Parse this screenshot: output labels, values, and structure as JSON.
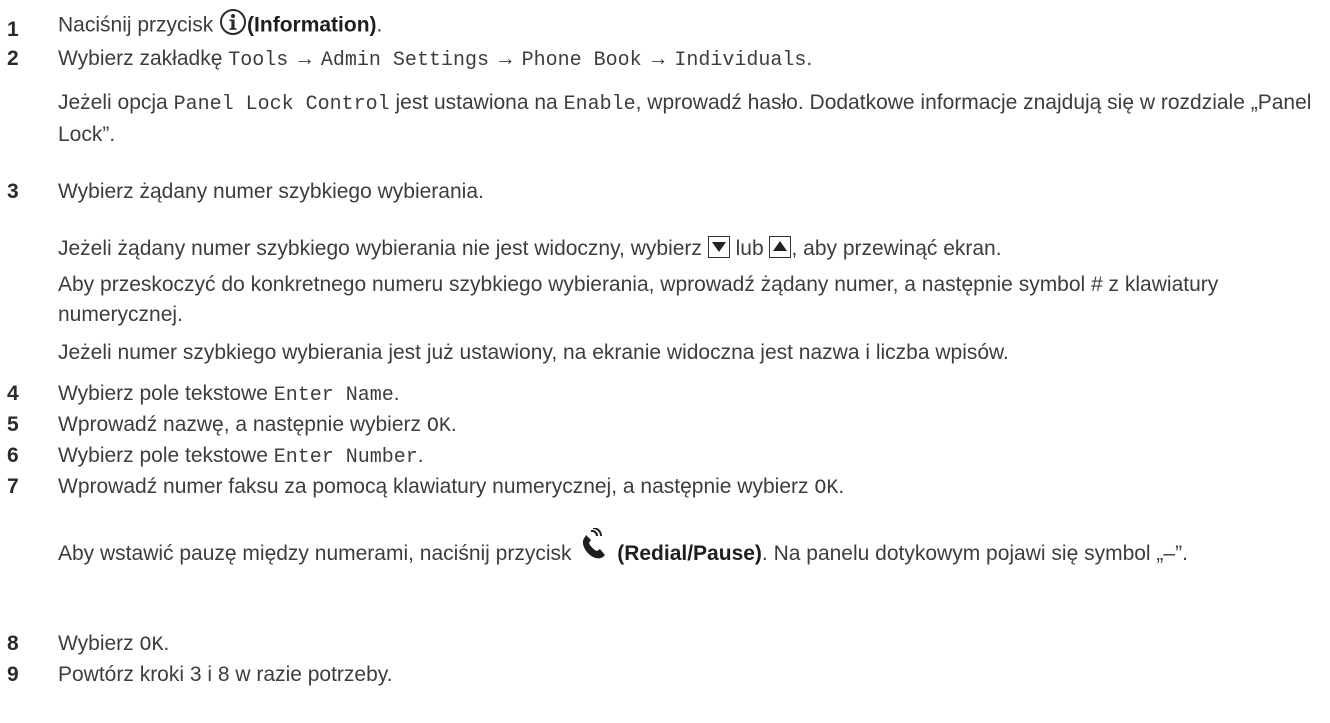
{
  "steps": [
    {
      "num": "1",
      "pre": "Naciśnij przycisk",
      "icon": "info-icon",
      "bold": "(Information)",
      "post": "."
    },
    {
      "num": "2",
      "pre": "Wybierz zakładkę",
      "path": [
        "Tools",
        "Admin Settings",
        "Phone Book",
        "Individuals"
      ],
      "post": "."
    },
    {
      "num": "3",
      "text": "Wybierz żądany numer szybkiego wybierania."
    },
    {
      "num": "4",
      "pre": "Wybierz pole tekstowe",
      "mono": "Enter Name",
      "post": "."
    },
    {
      "num": "5",
      "pre": "Wprowadź nazwę, a następnie wybierz",
      "mono": "OK",
      "post": "."
    },
    {
      "num": "6",
      "pre": "Wybierz pole tekstowe",
      "mono": "Enter Number",
      "post": "."
    },
    {
      "num": "7",
      "pre": "Wprowadź numer faksu za pomocą klawiatury numerycznej, a następnie wybierz",
      "mono": "OK",
      "post": "."
    },
    {
      "num": "8",
      "pre": "Wybierz",
      "mono": "OK",
      "post": "."
    },
    {
      "num": "9",
      "text": "Powtórz kroki 3 i 8 w razie potrzeby."
    }
  ],
  "arrow": "→",
  "note_panel_lock": {
    "a": "Jeżeli opcja",
    "m1": "Panel Lock Control",
    "b": "jest ustawiona na",
    "m2": "Enable",
    "c": ", wprowadź hasło. Dodatkowe informacje znajdują się w rozdziale „Panel Lock”."
  },
  "note_scroll": {
    "a": "Jeżeli żądany numer szybkiego wybierania nie jest widoczny, wybierz",
    "b": "lub",
    "c": ", aby przewinąć ekran."
  },
  "note_jump": "Aby przeskoczyć do konkretnego numeru szybkiego wybierania, wprowadź żądany numer, a następnie symbol # z klawiatury numerycznej.",
  "note_set": "Jeżeli numer szybkiego wybierania jest już ustawiony, na ekranie widoczna jest nazwa i liczba wpisów.",
  "note_pause": {
    "a": "Aby wstawić pauzę między numerami, naciśnij przycisk",
    "icon": "redial-pause-icon",
    "bold": "(Redial/Pause)",
    "b": ". Na panelu dotykowym pojawi się symbol „–”."
  },
  "colors": {
    "text": "#3d3d3d",
    "numbers": "#2b2b2b"
  }
}
